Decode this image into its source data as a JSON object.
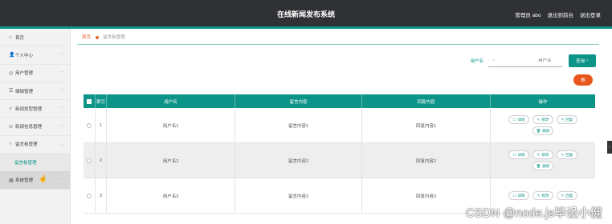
{
  "header": {
    "title": "在线新闻发布系统",
    "admin_label": "管理员 abo",
    "back_link": "退出到前台",
    "logout_link": "退出登录"
  },
  "sidebar": {
    "items": [
      {
        "label": "首页",
        "icon": "home-icon"
      },
      {
        "label": "个人中心",
        "icon": "user-icon"
      },
      {
        "label": "用户管理",
        "icon": "users-icon"
      },
      {
        "label": "编辑管理",
        "icon": "list-icon"
      },
      {
        "label": "新闻类型管理",
        "icon": "send-icon"
      },
      {
        "label": "新闻信息管理",
        "icon": "circle-icon"
      },
      {
        "label": "留言板管理",
        "icon": "bulb-icon"
      },
      {
        "label": "留言板管理",
        "icon": ""
      },
      {
        "label": "系统管理",
        "icon": "grid-icon"
      }
    ]
  },
  "breadcrumb": {
    "home": "首页",
    "current": "留言板管理"
  },
  "search": {
    "label": "用户名",
    "placeholder": "用户名",
    "query_button": "查询"
  },
  "delete_button": "删",
  "table": {
    "headers": [
      "索引",
      "用户名",
      "留言内容",
      "回复内容",
      "操作"
    ],
    "rows": [
      {
        "index": "1",
        "user": "用户名1",
        "message": "留言内容1",
        "reply": "回复内容1"
      },
      {
        "index": "2",
        "user": "用户名2",
        "message": "留言内容2",
        "reply": "回复内容2"
      },
      {
        "index": "3",
        "user": "用户名3",
        "message": "留言内容3",
        "reply": "回复内容3"
      }
    ],
    "actions": {
      "detail": "详情",
      "edit": "修改",
      "reply": "回复",
      "delete": "删除"
    }
  },
  "watermark": "CSDN @node.js毕设小健",
  "colors": {
    "accent": "#0d9488",
    "topbar": "#2f3134",
    "danger": "#e8561c"
  }
}
